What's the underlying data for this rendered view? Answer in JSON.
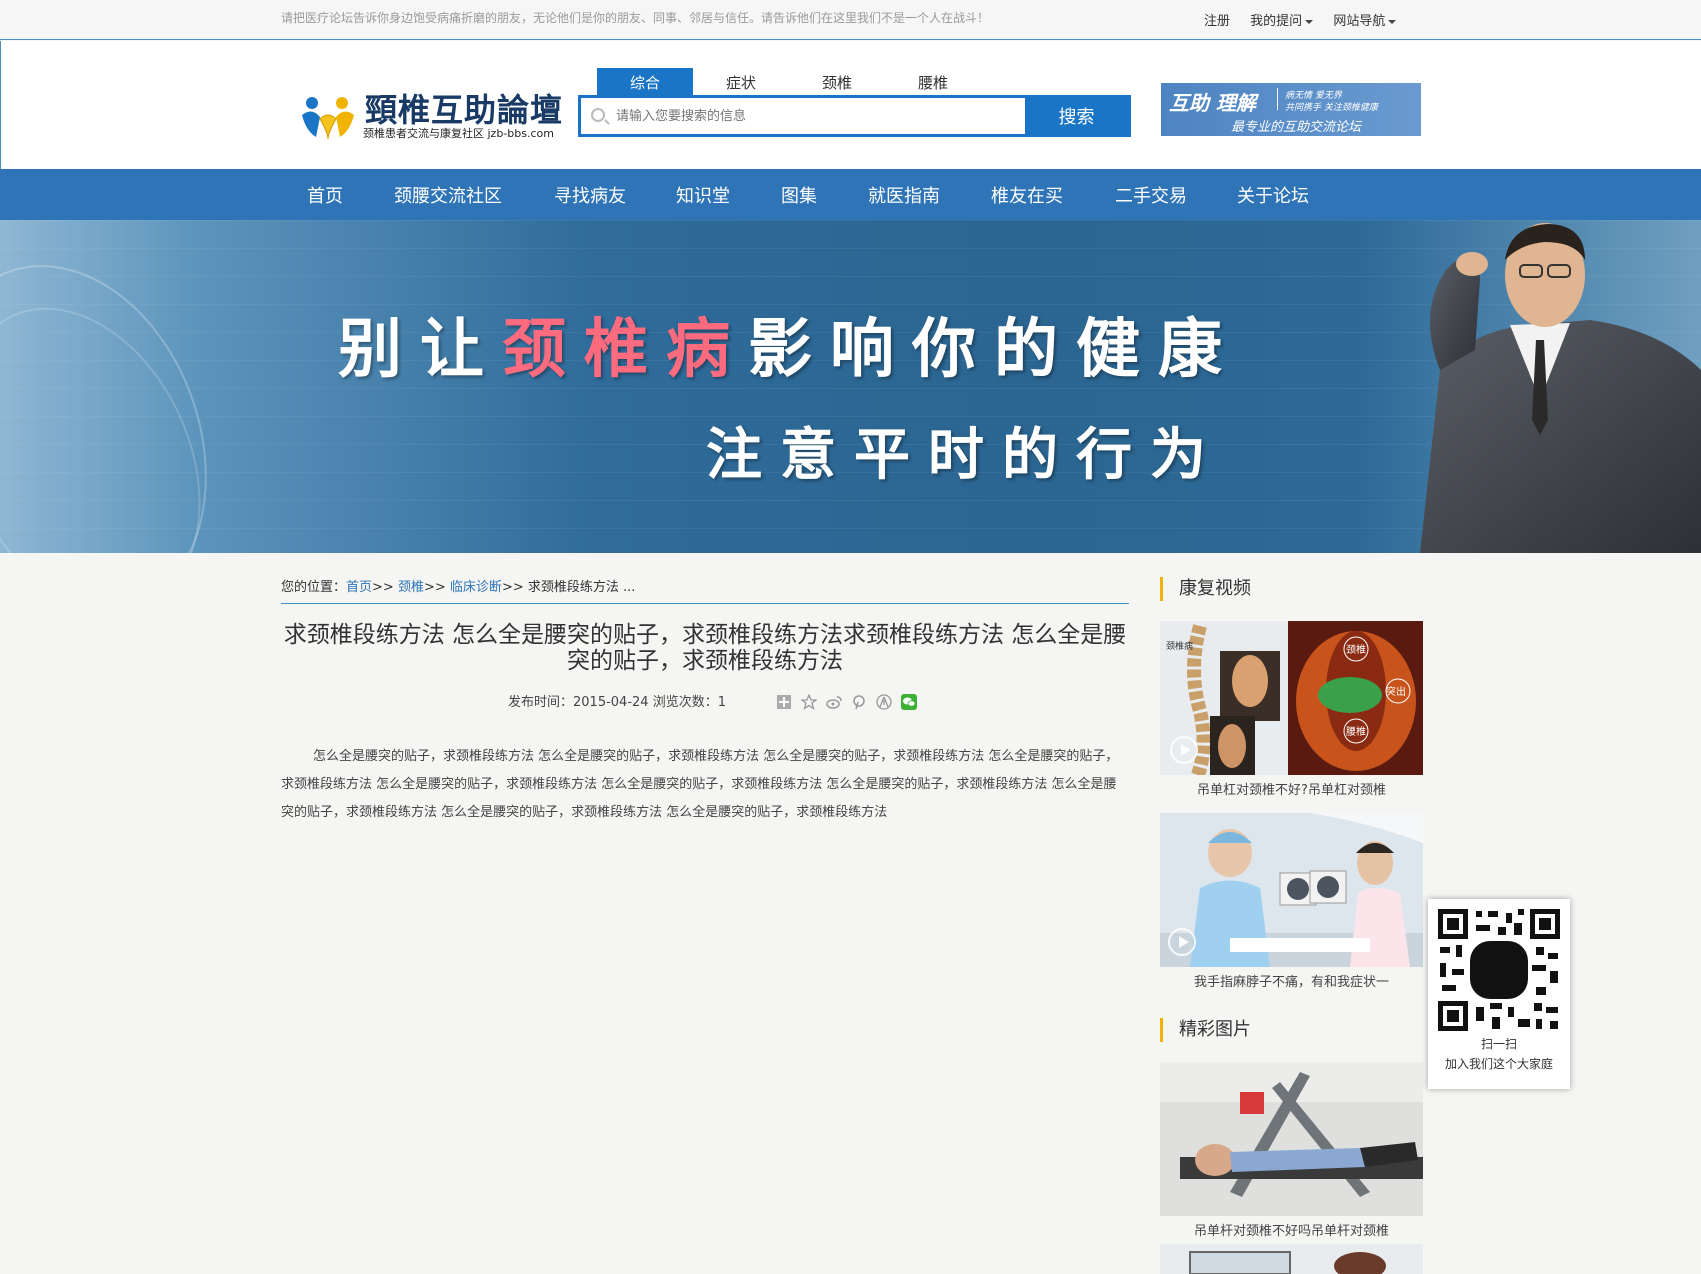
{
  "topbar": {
    "notice": "请把医疗论坛告诉你身边饱受病痛折磨的朋友，无论他们是你的朋友、同事、邻居与信任。请告诉他们在这里我们不是一个人在战斗！",
    "register": "注册",
    "my_questions": "我的提问",
    "site_nav": "网站导航"
  },
  "logo": {
    "title": "頸椎互助論壇",
    "subtitle": "颈椎患者交流与康复社区 jzb-bbs.com"
  },
  "search": {
    "tabs": [
      "综合",
      "症状",
      "颈椎",
      "腰椎"
    ],
    "active_tab": "综合",
    "placeholder": "请输入您要搜索的信息",
    "button": "搜索"
  },
  "ad": {
    "big": "互助 理解",
    "small1": "病无情 爱无界",
    "small2": "共同携手 关注颈椎健康",
    "small3": "最专业的互助交流论坛"
  },
  "nav": {
    "items": [
      "首页",
      "颈腰交流社区",
      "寻找病友",
      "知识堂",
      "图集",
      "就医指南",
      "椎友在买",
      "二手交易",
      "关于论坛"
    ]
  },
  "hero": {
    "line1_a": "别让",
    "line1_b": "颈椎病",
    "line1_c": "影响你的健康",
    "line2": "注意平时的行为"
  },
  "breadcrumb": {
    "label": "您的位置：",
    "home": "首页",
    "sep": ">>",
    "cat1": "颈椎",
    "cat2": "临床诊断",
    "current": "求颈椎段练方法 ..."
  },
  "article": {
    "title": "求颈椎段练方法 怎么全是腰突的贴子，求颈椎段练方法求颈椎段练方法 怎么全是腰突的贴子，求颈椎段练方法",
    "publish_label": "发布时间：",
    "publish_date": "2015-04-24",
    "views_label": "浏览次数：",
    "views": "1",
    "body": "怎么全是腰突的贴子，求颈椎段练方法 怎么全是腰突的贴子，求颈椎段练方法 怎么全是腰突的贴子，求颈椎段练方法 怎么全是腰突的贴子，求颈椎段练方法 怎么全是腰突的贴子，求颈椎段练方法 怎么全是腰突的贴子，求颈椎段练方法 怎么全是腰突的贴子，求颈椎段练方法 怎么全是腰突的贴子，求颈椎段练方法 怎么全是腰突的贴子，求颈椎段练方法 怎么全是腰突的贴子，求颈椎段练方法"
  },
  "sidebar": {
    "videos_heading": "康复视频",
    "videos": [
      {
        "caption": "吊单杠对颈椎不好?吊单杠对颈椎",
        "img_text_1": "颈椎病",
        "img_text_2": "颈椎",
        "img_text_3": "突出",
        "img_text_4": "腰椎"
      },
      {
        "caption": "我手指麻脖子不痛，有和我症状一"
      }
    ],
    "pictures_heading": "精彩图片",
    "pictures": [
      {
        "caption": "吊单杆对颈椎不好吗吊单杆对颈椎"
      }
    ]
  },
  "qr": {
    "line1": "扫一扫",
    "line2": "加入我们这个大家庭"
  },
  "colors": {
    "brand_blue": "#2e74b7",
    "search_blue": "#1a75c6",
    "accent_yellow": "#f0b400",
    "hero_red": "#ff6b7e"
  },
  "icons": [
    "search-icon",
    "share-plus-icon",
    "star-icon",
    "weibo-icon",
    "pinterest-icon",
    "renren-icon",
    "wechat-icon",
    "play-icon",
    "qr-code-icon"
  ]
}
